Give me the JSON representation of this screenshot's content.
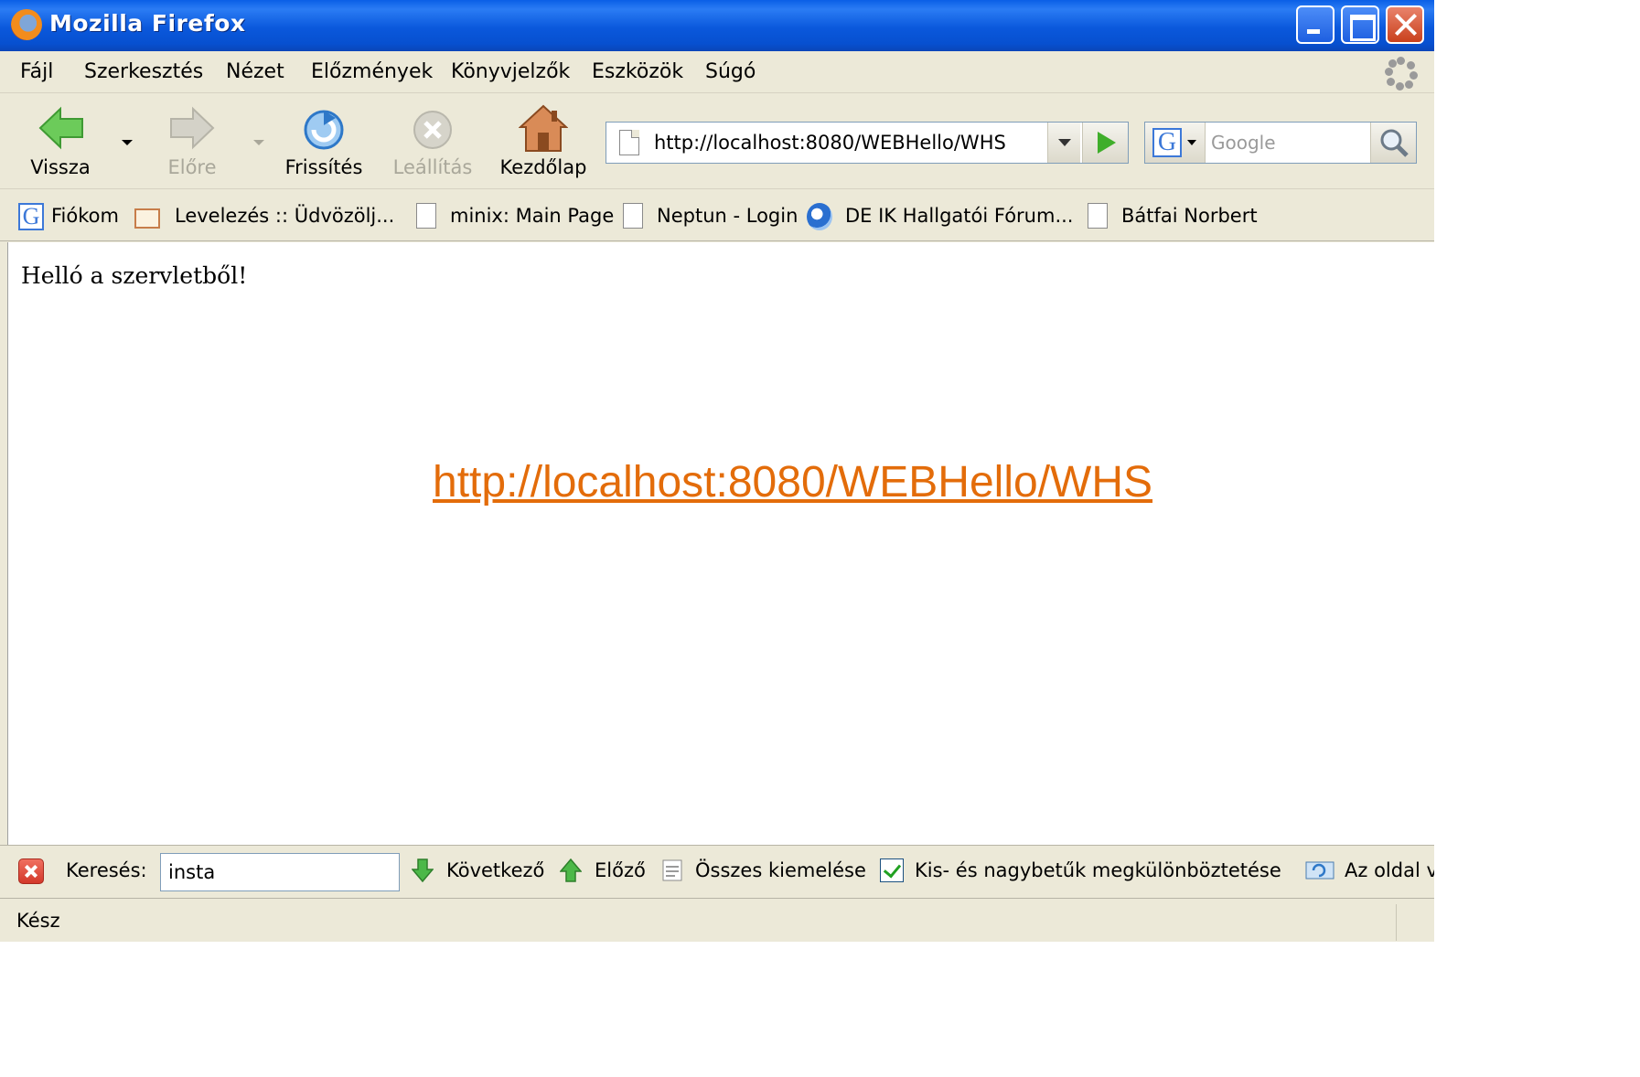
{
  "window": {
    "title": "Mozilla Firefox"
  },
  "menu": {
    "items": [
      {
        "label": "Fájl"
      },
      {
        "label": "Szerkesztés"
      },
      {
        "label": "Nézet"
      },
      {
        "label": "Előzmények"
      },
      {
        "label": "Könyvjelzők"
      },
      {
        "label": "Eszközök"
      },
      {
        "label": "Súgó"
      }
    ]
  },
  "navigation": {
    "back_label": "Vissza",
    "forward_label": "Előre",
    "reload_label": "Frissítés",
    "stop_label": "Leállítás",
    "home_label": "Kezdőlap",
    "url": "http://localhost:8080/WEBHello/WHS",
    "search_placeholder": "Google"
  },
  "bookmarks": [
    {
      "label": "Fiókom",
      "icon": "google-icon"
    },
    {
      "label": "Levelezés :: Üdvözölj...",
      "icon": "mail-icon"
    },
    {
      "label": "minix: Main Page",
      "icon": "page-icon"
    },
    {
      "label": "Neptun - Login",
      "icon": "page-icon"
    },
    {
      "label": "DE IK Hallgatói Fórum...",
      "icon": "ie-icon"
    },
    {
      "label": "Bátfai Norbert",
      "icon": "page-icon"
    }
  ],
  "content": {
    "text": "Helló a szervletből!"
  },
  "findbar": {
    "label": "Keresés:",
    "value": "insta",
    "next_label": "Következő",
    "prev_label": "Előző",
    "highlight_label": "Összes kiemelése",
    "match_case_label": "Kis- és nagybetűk megkülönböztetése",
    "match_case_checked": true,
    "wrap_label": "Az oldal v"
  },
  "status": {
    "text": "Kész"
  },
  "annotation": {
    "link": "http://localhost:8080/WEBHello/WHS",
    "color": "#E36C0A"
  }
}
